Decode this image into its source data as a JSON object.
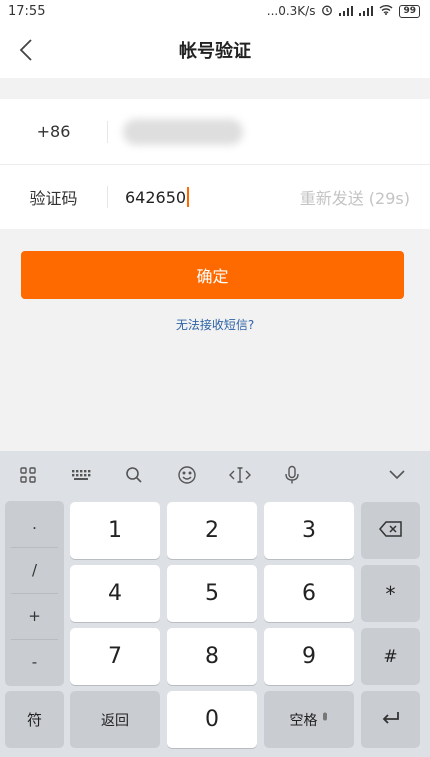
{
  "status_bar": {
    "time": "17:55",
    "network_speed": "...0.3K/s",
    "battery": "99"
  },
  "nav": {
    "title": "帐号验证"
  },
  "form": {
    "country_code": "+86",
    "code_label": "验证码",
    "code_value": "642650",
    "resend_label": "重新发送 (29s)"
  },
  "actions": {
    "confirm_label": "确定",
    "cant_receive_label": "无法接收短信?"
  },
  "keyboard": {
    "digits": [
      "1",
      "2",
      "3",
      "4",
      "5",
      "6",
      "7",
      "8",
      "9",
      "0"
    ],
    "symbols": [
      ".",
      "/",
      "+",
      "-"
    ],
    "right_keys": [
      "*",
      "#"
    ],
    "symbol_key": "符",
    "return_key": "返回",
    "space_key": "空格"
  },
  "colors": {
    "accent": "#ff6a00",
    "link": "#2d63a6",
    "keyboard_bg": "#dde0e4"
  }
}
